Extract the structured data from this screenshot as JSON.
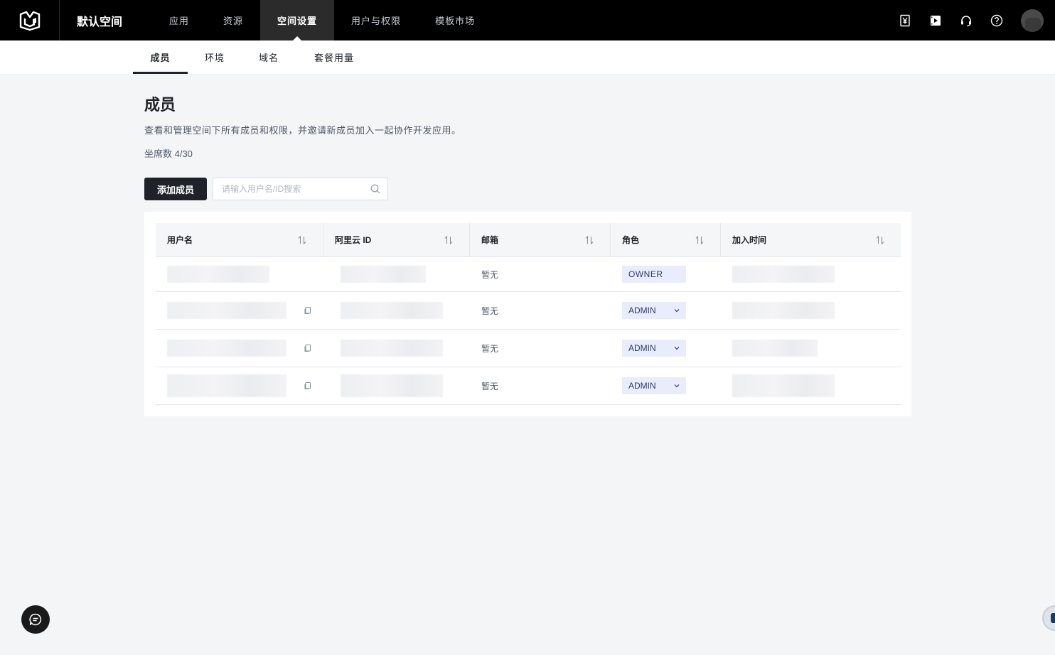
{
  "topbar": {
    "workspace": "默认空间",
    "nav": [
      {
        "label": "应用"
      },
      {
        "label": "资源"
      },
      {
        "label": "空间设置"
      },
      {
        "label": "用户与权限"
      },
      {
        "label": "模板市场"
      }
    ],
    "active_nav": "空间设置",
    "icons": [
      "yen-bill-icon",
      "video-icon",
      "headset-icon",
      "help-icon"
    ]
  },
  "subtabs": [
    {
      "label": "成员"
    },
    {
      "label": "环境"
    },
    {
      "label": "域名"
    },
    {
      "label": "套餐用量"
    }
  ],
  "active_subtab": "成员",
  "page": {
    "title": "成员",
    "description": "查看和管理空间下所有成员和权限，并邀请新成员加入一起协作开发应用。",
    "seat_count": "坐席数 4/30",
    "add_button": "添加成员",
    "search_placeholder": "请输入用户名/ID搜索"
  },
  "table": {
    "columns": [
      {
        "label": "用户名"
      },
      {
        "label": "阿里云 ID"
      },
      {
        "label": "邮箱"
      },
      {
        "label": "角色"
      },
      {
        "label": "加入时间"
      }
    ],
    "rows": [
      {
        "username": "",
        "aliyun_id": "",
        "email": "暂无",
        "role": "OWNER",
        "joined": ""
      },
      {
        "username": "",
        "aliyun_id": "",
        "email": "暂无",
        "role": "ADMIN",
        "joined": ""
      },
      {
        "username": "",
        "aliyun_id": "",
        "email": "暂无",
        "role": "ADMIN",
        "joined": ""
      },
      {
        "username": "",
        "aliyun_id": "",
        "email": "暂无",
        "role": "ADMIN",
        "joined": ""
      }
    ]
  },
  "colors": {
    "topbar_bg": "#000000",
    "active_nav_bg": "#2b2b2b",
    "page_bg": "#f4f5f7",
    "primary_button": "#1f2329",
    "role_badge_bg": "#e8ecfb",
    "role_badge_text": "#2f3b69"
  }
}
